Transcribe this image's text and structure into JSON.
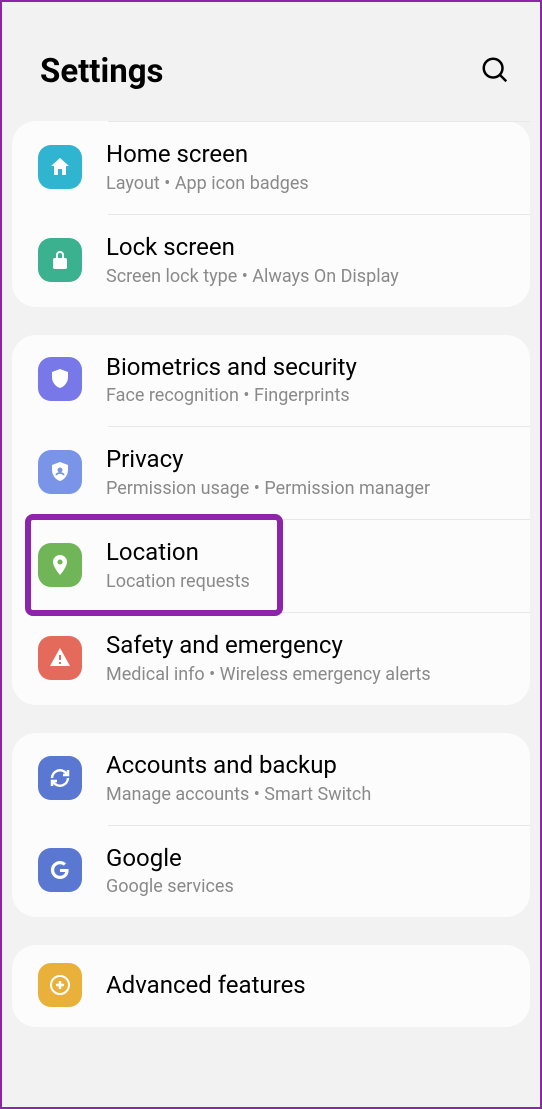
{
  "header": {
    "title": "Settings"
  },
  "groups": [
    {
      "items": [
        {
          "id": "home-screen",
          "title": "Home screen",
          "subtitle": "Layout  •  App icon badges",
          "color": "#30b5d1",
          "icon": "home"
        },
        {
          "id": "lock-screen",
          "title": "Lock screen",
          "subtitle": "Screen lock type  •  Always On Display",
          "color": "#3bb18f",
          "icon": "lock"
        }
      ]
    },
    {
      "items": [
        {
          "id": "biometrics",
          "title": "Biometrics and security",
          "subtitle": "Face recognition  •  Fingerprints",
          "color": "#7878e8",
          "icon": "shield"
        },
        {
          "id": "privacy",
          "title": "Privacy",
          "subtitle": "Permission usage  •  Permission manager",
          "color": "#7a95e8",
          "icon": "shield-user"
        },
        {
          "id": "location",
          "title": "Location",
          "subtitle": "Location requests",
          "color": "#70b557",
          "icon": "pin",
          "highlighted": true
        },
        {
          "id": "safety",
          "title": "Safety and emergency",
          "subtitle": "Medical info  •  Wireless emergency alerts",
          "color": "#e46b5c",
          "icon": "alert"
        }
      ]
    },
    {
      "items": [
        {
          "id": "accounts",
          "title": "Accounts and backup",
          "subtitle": "Manage accounts  •  Smart Switch",
          "color": "#5a78d1",
          "icon": "sync"
        },
        {
          "id": "google",
          "title": "Google",
          "subtitle": "Google services",
          "color": "#5a78d1",
          "icon": "google"
        }
      ]
    },
    {
      "items": [
        {
          "id": "advanced",
          "title": "Advanced features",
          "subtitle": "",
          "color": "#eab13a",
          "icon": "plus"
        }
      ]
    }
  ]
}
